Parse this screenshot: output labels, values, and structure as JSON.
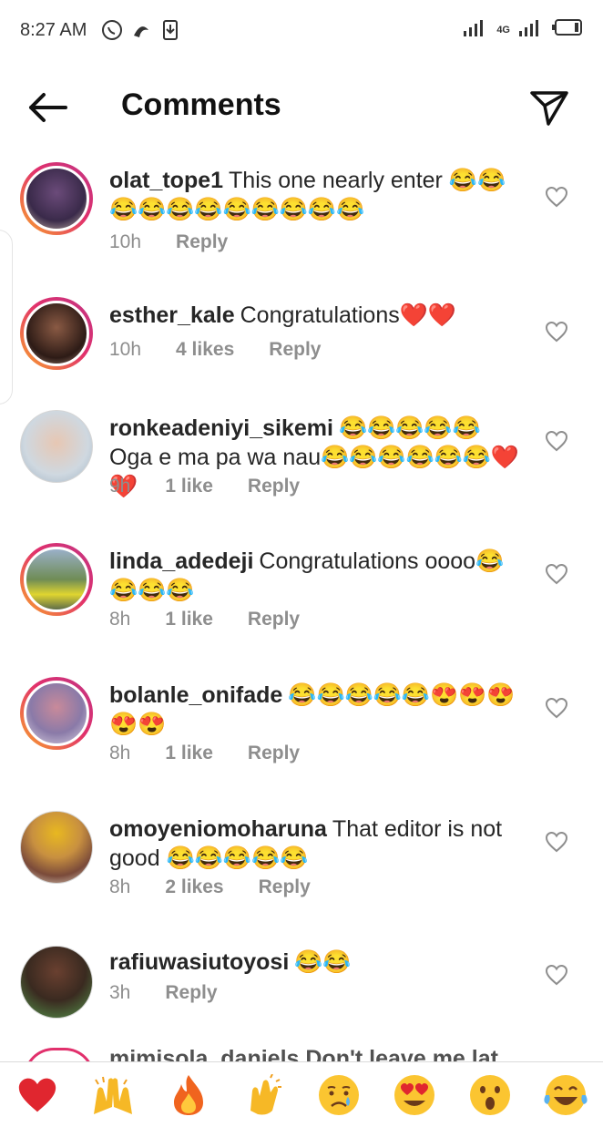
{
  "status_bar": {
    "time": "8:27 AM",
    "network": "4G",
    "icons": [
      "whatsapp-icon",
      "app-icon",
      "download-icon",
      "signal-icon",
      "battery-icon"
    ]
  },
  "header": {
    "title": "Comments",
    "icons": [
      "back-arrow-icon",
      "send-icon"
    ]
  },
  "comments": [
    {
      "username": "olat_tope1",
      "text": "This one nearly enter 😂😂😂😂😂😂😂😂😂😂😂",
      "time": "10h",
      "likes": "",
      "reply": "Reply"
    },
    {
      "username": "esther_kale",
      "text": "Congratulations❤️❤️",
      "time": "10h",
      "likes": "4 likes",
      "reply": "Reply"
    },
    {
      "username": "ronkeadeniyi_sikemi",
      "text": "😂😂😂😂😂 Oga e ma pa wa nau😂😂😂😂😂😂❤️❤️",
      "time": "9h",
      "likes": "1 like",
      "reply": "Reply"
    },
    {
      "username": "linda_adedeji",
      "text": "Congratulations oooo😂😂😂😂",
      "time": "8h",
      "likes": "1 like",
      "reply": "Reply"
    },
    {
      "username": "bolanle_onifade",
      "text": "😂😂😂😂😂😍😍😍😍😍",
      "time": "8h",
      "likes": "1 like",
      "reply": "Reply"
    },
    {
      "username": "omoyeniomoharuna",
      "text": "That editor is not good 😂😂😂😂😂",
      "time": "8h",
      "likes": "2 likes",
      "reply": "Reply"
    },
    {
      "username": "rafiuwasiutoyosi",
      "text": "😂😂",
      "time": "3h",
      "likes": "",
      "reply": "Reply"
    }
  ],
  "partial_comment": {
    "text": "mimisola_daniels Don't leave me lat"
  },
  "reactions": [
    {
      "icon": "red-heart-icon",
      "glyph": "❤️"
    },
    {
      "icon": "raising-hands-icon",
      "glyph": "🙌"
    },
    {
      "icon": "fire-icon",
      "glyph": "🔥"
    },
    {
      "icon": "clapping-hands-icon",
      "glyph": "👏"
    },
    {
      "icon": "crying-face-icon",
      "glyph": "😢"
    },
    {
      "icon": "heart-eyes-icon",
      "glyph": "😍"
    },
    {
      "icon": "surprised-face-icon",
      "glyph": "😮"
    },
    {
      "icon": "laughing-tears-icon",
      "glyph": "😂"
    }
  ]
}
